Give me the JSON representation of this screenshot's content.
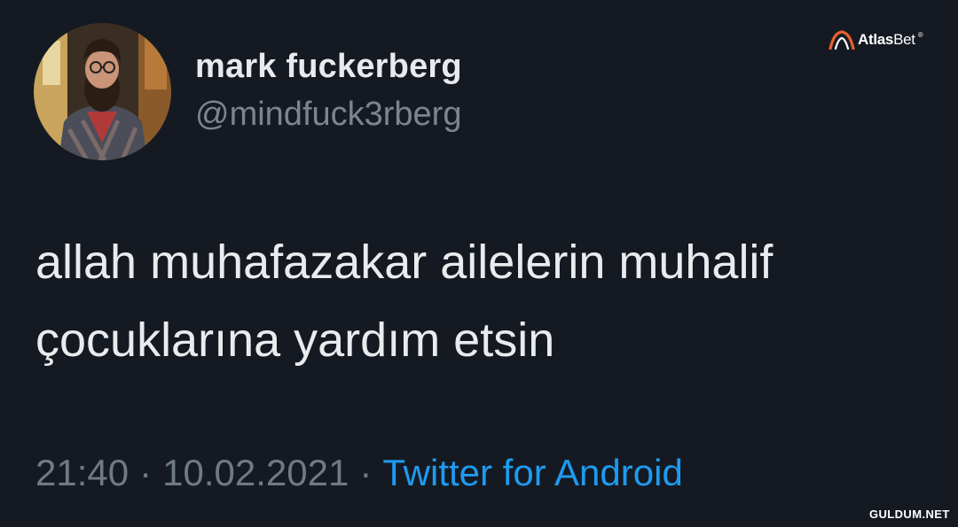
{
  "author": {
    "display_name": "mark fuckerberg",
    "handle": "@mindfuck3rberg",
    "avatar_icon": "profile-photo"
  },
  "tweet": {
    "lines": [
      "allah muhafazakar ailelerin muhalif",
      "çocuklarına yardım etsin"
    ]
  },
  "meta": {
    "time": "21:40",
    "separator": "·",
    "date": "10.02.2021",
    "source": "Twitter for Android"
  },
  "branding": {
    "logo_prefix": "Atlas",
    "logo_suffix": "Bet",
    "logo_mark": "®",
    "watermark": "GULDUM.NET"
  },
  "colors": {
    "background": "#151a22",
    "name": "#e8eaed",
    "handle": "#7b8590",
    "text": "#e9ebee",
    "meta": "#6f7a86",
    "link": "#1e9bf0",
    "logo_accent": "#e8612c"
  }
}
